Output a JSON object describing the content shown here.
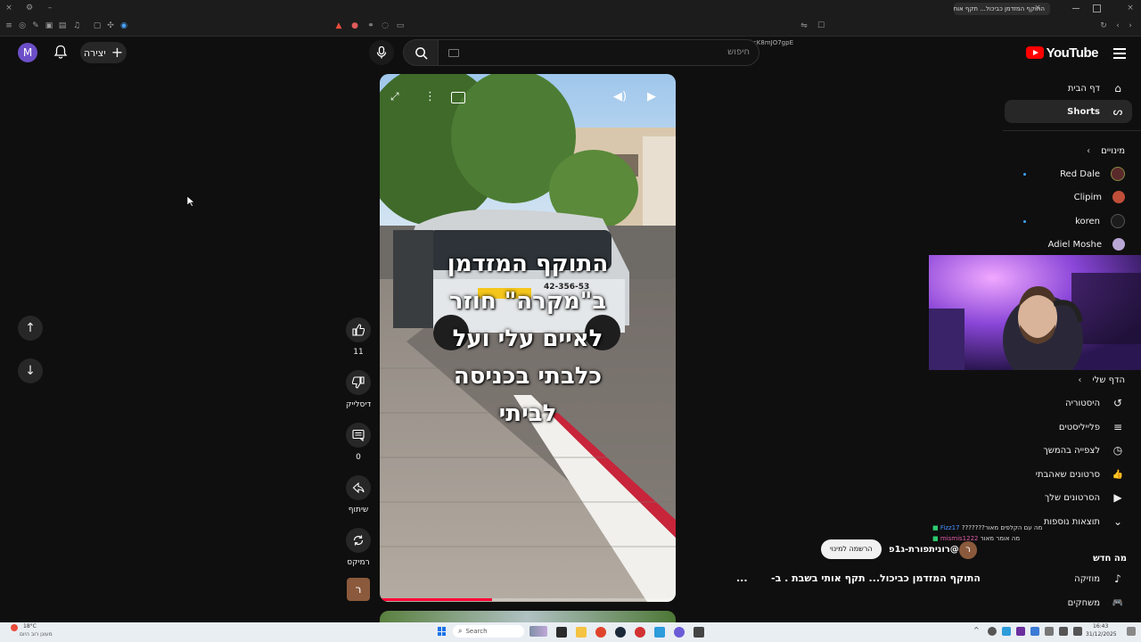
{
  "browser": {
    "tab_title": "התוקף המזדמן כביכול... תקף אות",
    "url": "youtube.com/shorts/kcK8mJO7gpE",
    "new_tab": "+",
    "close_tab": "×"
  },
  "header": {
    "logo_text": "YouTube",
    "search_placeholder": "חיפוש",
    "create_label": "יצירה",
    "avatar_letter": "M"
  },
  "sidebar": {
    "home": "דף הבית",
    "shorts": "Shorts",
    "subscriptions_title": "מינויים",
    "subscriptions": [
      {
        "name": "Red Dale",
        "color": "#5a2a2a",
        "dot": true
      },
      {
        "name": "Clipim",
        "color": "#c04f3a",
        "dot": false
      },
      {
        "name": "koren",
        "color": "#1c1c1c",
        "dot": true
      },
      {
        "name": "Adiel Moshe",
        "color": "#b9a6d4",
        "dot": false
      }
    ],
    "you_title": "הדף שלי",
    "you_items": [
      {
        "label": "היסטוריה",
        "icon": "history-icon",
        "glyph": "↺"
      },
      {
        "label": "פלייליסטים",
        "icon": "playlist-icon",
        "glyph": "≡"
      },
      {
        "label": "לצפייה בהמשך",
        "icon": "clock-icon",
        "glyph": "◷"
      },
      {
        "label": "סרטונים שאהבתי",
        "icon": "like-icon",
        "glyph": "👍"
      },
      {
        "label": "הסרטונים שלך",
        "icon": "video-icon",
        "glyph": "▶"
      },
      {
        "label": "תוצאות נוספות",
        "icon": "chevron-down-icon",
        "glyph": "⌄"
      }
    ],
    "explore_title": "מה חדש",
    "explore_items": [
      {
        "label": "מוזיקה",
        "icon": "music-icon",
        "glyph": "♪"
      },
      {
        "label": "משחקים",
        "icon": "gamepad-icon",
        "glyph": "🎮"
      }
    ]
  },
  "short": {
    "overlay_lines": [
      "התוקף המזדמן",
      "ב\"מקרה\" חוזר",
      "לאיים עלי ועל",
      "כלבתי בכניסה",
      "לביתי"
    ],
    "plate": "42-356-53",
    "likes": "11",
    "dislike_label": "דיסלייק",
    "comments": "0",
    "share_label": "שיתוף",
    "remix_label": "רמיקס",
    "channel_letter": "ר",
    "progress": 0.38,
    "title": "התוקף המזדמן כביכול... תקף אותי בשבת  . ב-",
    "more": "...",
    "channel_handle": "@רוניתפורת-ג1פ",
    "subscribe_label": "הרשמה למינוי"
  },
  "chat": [
    {
      "user": "Fizz17",
      "msg": "???????מה עם הקלפים מאור",
      "color": "#4a90ff"
    },
    {
      "user": "mismis1222",
      "msg": "מה אומר מאור",
      "color": "#2ecc71"
    }
  ],
  "taskbar": {
    "weather_temp": "18°C",
    "weather_desc": "מעונן רוב היום",
    "search_label": "Search",
    "time": "16:43",
    "date": "31/12/2025"
  }
}
